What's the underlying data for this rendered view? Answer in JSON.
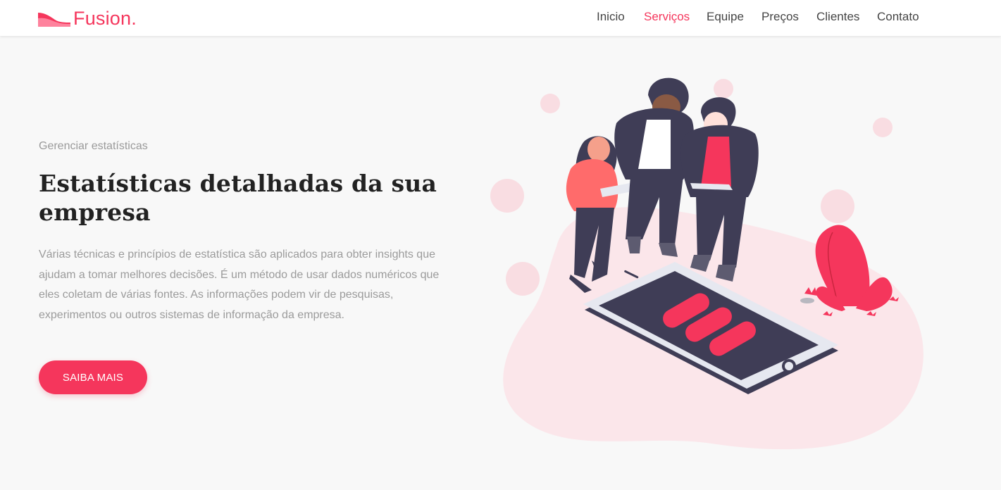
{
  "brand": {
    "name": "Fusion.",
    "accent_color": "#f5365c"
  },
  "nav": {
    "items": [
      {
        "label": "Inicio",
        "active": false
      },
      {
        "label": "Serviços",
        "active": true
      },
      {
        "label": "Equipe",
        "active": false
      },
      {
        "label": "Preços",
        "active": false
      },
      {
        "label": "Clientes",
        "active": false
      },
      {
        "label": "Contato",
        "active": false
      }
    ]
  },
  "hero": {
    "eyebrow": "Gerenciar estatísticas",
    "title": "Estatísticas detalhadas da sua empresa",
    "description": "Várias técnicas e princípios de estatística são aplicados para obter insights que ajudam a tomar melhores decisões. É um método de usar dados numéricos que eles coletam de várias fontes. As informações podem vir de pesquisas, experimentos ou outros sistemas de informação da empresa.",
    "cta_label": "SAIBA MAIS"
  },
  "illustration": {
    "icon": "team-with-smartphone-illustration"
  }
}
